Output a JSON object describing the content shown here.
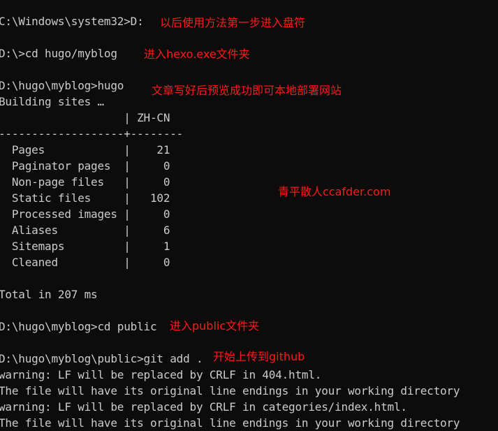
{
  "terminal": {
    "lines": [
      "C:\\Windows\\system32>D:",
      "D:\\>cd hugo/myblog",
      "D:\\hugo\\myblog>hugo",
      "Building sites …",
      "                   | ZH-CN",
      "-------------------+--------",
      "  Pages            |    21",
      "  Paginator pages  |     0",
      "  Non-page files   |     0",
      "  Static files     |   102",
      "  Processed images |     0",
      "  Aliases          |     6",
      "  Sitemaps         |     1",
      "  Cleaned          |     0",
      "Total in 207 ms",
      "D:\\hugo\\myblog>cd public",
      "D:\\hugo\\myblog\\public>git add .",
      "warning: LF will be replaced by CRLF in 404.html.",
      "The file will have its original line endings in your working directory",
      "warning: LF will be replaced by CRLF in categories/index.html.",
      "The file will have its original line endings in your working directory"
    ]
  },
  "annotations": {
    "step1": "以后使用方法第一步进入盘符",
    "step2": "进入hexo.exe文件夹",
    "step3": "文章写好后预览成功即可本地部署网站",
    "watermark": "青平散人ccafder.com",
    "step4": "进入public文件夹",
    "step5": "开始上传到github"
  },
  "colors": {
    "background": "#0c0c0c",
    "text": "#cccccc",
    "annotation": "#ff1a1a"
  }
}
